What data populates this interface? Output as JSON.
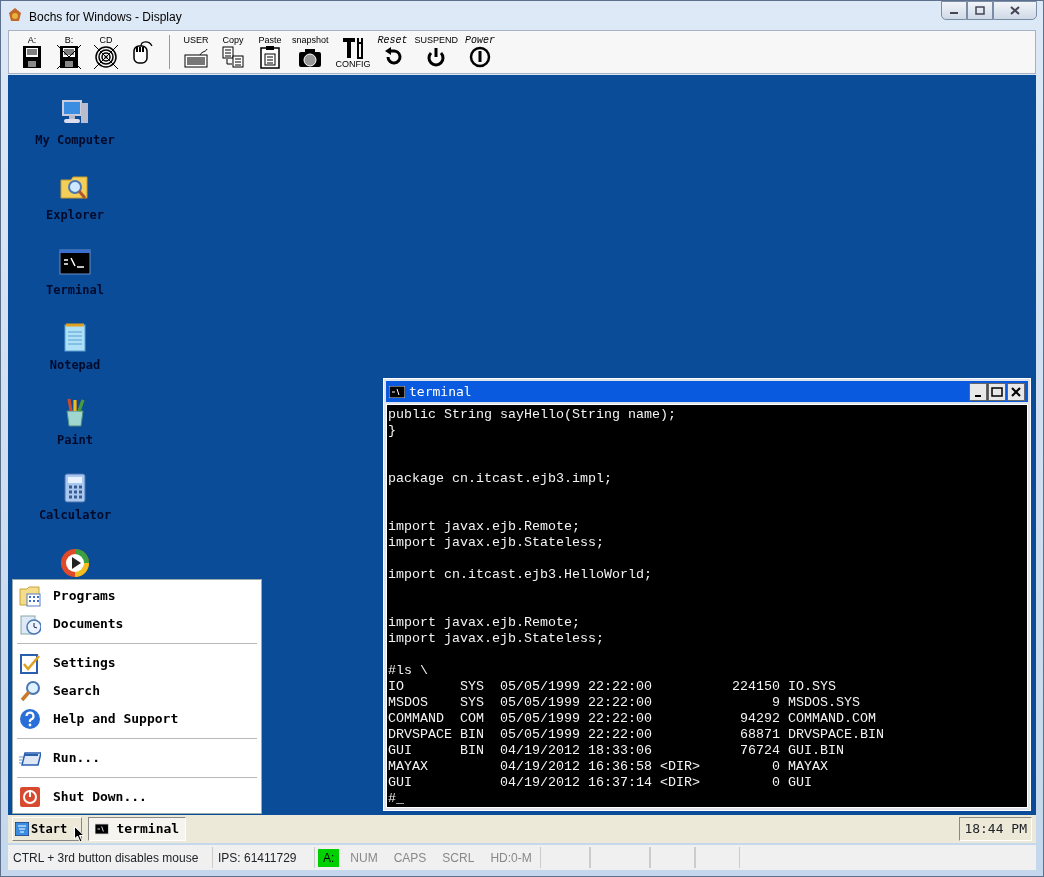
{
  "window": {
    "title": "Bochs for Windows - Display"
  },
  "toolbar": {
    "devices": [
      {
        "kind": "floppy",
        "label": "A:",
        "crossed": false
      },
      {
        "kind": "floppy",
        "label": "B:",
        "crossed": true
      },
      {
        "kind": "cdrom",
        "label": "CD",
        "crossed": true
      },
      {
        "kind": "mouse",
        "crossed": false
      }
    ],
    "actions": [
      {
        "kind": "keyboard",
        "label": "USER"
      },
      {
        "kind": "copy",
        "label": "Copy"
      },
      {
        "kind": "paste",
        "label": "Paste"
      },
      {
        "kind": "camera",
        "label": "snapshot"
      },
      {
        "kind": "config",
        "label": "CONFIG"
      },
      {
        "kind": "reset",
        "label": "Reset"
      },
      {
        "kind": "suspend",
        "label": "SUSPEND"
      },
      {
        "kind": "power",
        "label": "Power"
      }
    ]
  },
  "desktop_icons": [
    {
      "kind": "computer",
      "label": "My Computer"
    },
    {
      "kind": "explorer",
      "label": "Explorer"
    },
    {
      "kind": "terminal",
      "label": "Terminal"
    },
    {
      "kind": "notepad",
      "label": "Notepad"
    },
    {
      "kind": "paint",
      "label": "Paint"
    },
    {
      "kind": "calculator",
      "label": "Calculator"
    },
    {
      "kind": "media"
    }
  ],
  "terminal": {
    "title": "terminal",
    "lines": [
      {
        "kind": "text",
        "text": "public String sayHello(String name);"
      },
      {
        "kind": "text",
        "text": "}"
      },
      {
        "kind": "blank"
      },
      {
        "kind": "blank"
      },
      {
        "kind": "text",
        "text": "package cn.itcast.ejb3.impl;"
      },
      {
        "kind": "blank"
      },
      {
        "kind": "blank"
      },
      {
        "kind": "text",
        "text": "import javax.ejb.Remote;"
      },
      {
        "kind": "text",
        "text": "import javax.ejb.Stateless;"
      },
      {
        "kind": "blank"
      },
      {
        "kind": "text",
        "text": "import cn.itcast.ejb3.HelloWorld;"
      },
      {
        "kind": "blank"
      },
      {
        "kind": "blank"
      },
      {
        "kind": "text",
        "text": "import javax.ejb.Remote;"
      },
      {
        "kind": "text",
        "text": "import javax.ejb.Stateless;"
      },
      {
        "kind": "blank"
      },
      {
        "kind": "text",
        "text": "#ls \\"
      },
      {
        "kind": "text",
        "text": "IO       SYS  05/05/1999 22:22:00          224150 IO.SYS"
      },
      {
        "kind": "text",
        "text": "MSDOS    SYS  05/05/1999 22:22:00               9 MSDOS.SYS"
      },
      {
        "kind": "text",
        "text": "COMMAND  COM  05/05/1999 22:22:00           94292 COMMAND.COM"
      },
      {
        "kind": "text",
        "text": "DRVSPACE BIN  05/05/1999 22:22:00           68871 DRVSPACE.BIN"
      },
      {
        "kind": "text",
        "text": "GUI      BIN  04/19/2012 18:33:06           76724 GUI.BIN"
      },
      {
        "kind": "text",
        "text": "MAYAX         04/19/2012 16:36:58 <DIR>         0 MAYAX"
      },
      {
        "kind": "text",
        "text": "GUI           04/19/2012 16:37:14 <DIR>         0 GUI"
      },
      {
        "kind": "text",
        "text": "#_"
      }
    ]
  },
  "start_menu": {
    "groups": [
      [
        {
          "kind": "programs",
          "label": "Programs"
        },
        {
          "kind": "documents",
          "label": "Documents"
        }
      ],
      [
        {
          "kind": "settings",
          "label": "Settings"
        },
        {
          "kind": "search",
          "label": "Search"
        },
        {
          "kind": "help",
          "label": "Help and Support"
        }
      ],
      [
        {
          "kind": "run",
          "label": "Run..."
        }
      ],
      [
        {
          "kind": "shutdown",
          "label": "Shut Down..."
        }
      ]
    ]
  },
  "taskbar": {
    "start": "Start",
    "tasks": [
      {
        "label": "terminal"
      }
    ],
    "clock": "18:44 PM"
  },
  "status_bar": {
    "message": "CTRL + 3rd button disables mouse",
    "ips": "IPS: 61411729",
    "indicators": [
      {
        "label": "A:",
        "on": true
      },
      {
        "label": "NUM",
        "on": false
      },
      {
        "label": "CAPS",
        "on": false
      },
      {
        "label": "SCRL",
        "on": false
      },
      {
        "label": "HD:0-M",
        "on": false
      }
    ]
  }
}
